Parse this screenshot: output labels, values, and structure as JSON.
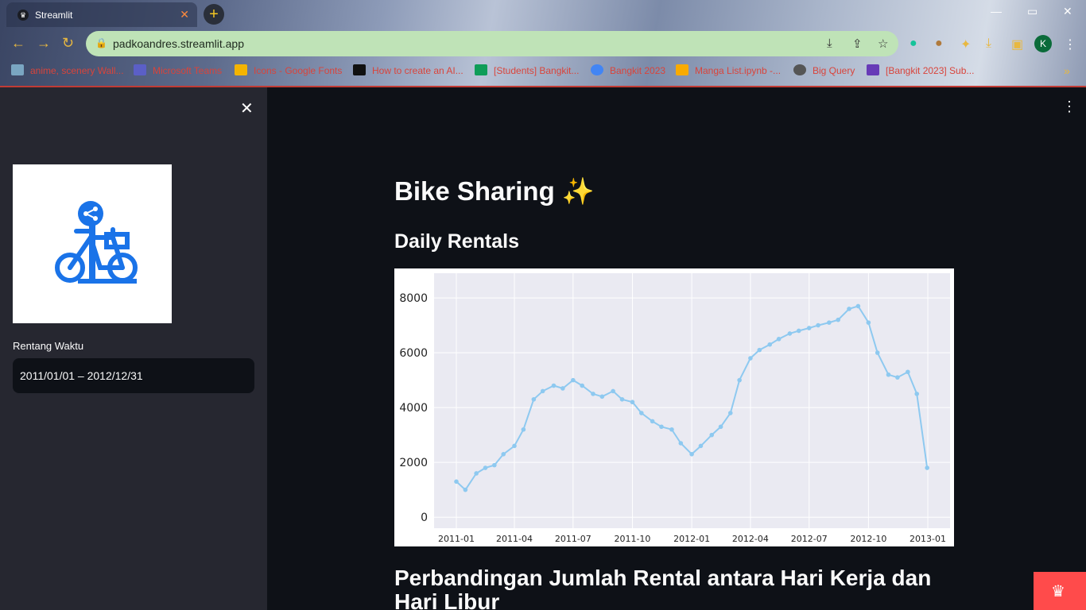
{
  "browser": {
    "tab_title": "Streamlit",
    "tab_close": "✕",
    "new_tab": "+",
    "url": "padkoandres.streamlit.app",
    "avatar_letter": "K",
    "bookmarks": [
      {
        "label": "anime, scenery Wall...",
        "icon": "image-icon",
        "color": "#7aa6c2"
      },
      {
        "label": "Microsoft Teams",
        "icon": "teams-icon",
        "color": "#5b5fc7"
      },
      {
        "label": "Icons - Google Fonts",
        "icon": "google-fonts-icon",
        "color": "#f4b400"
      },
      {
        "label": "How to create an AI...",
        "icon": "dev-icon",
        "color": "#111111"
      },
      {
        "label": "[Students] Bangkit...",
        "icon": "sheets-icon",
        "color": "#0f9d58"
      },
      {
        "label": "Bangkit 2023",
        "icon": "google-icon",
        "color": "#4285f4"
      },
      {
        "label": "Manga List.ipynb -...",
        "icon": "colab-icon",
        "color": "#f9ab00"
      },
      {
        "label": "Big Query",
        "icon": "bigquery-icon",
        "color": "#555555"
      },
      {
        "label": "[Bangkit 2023] Sub...",
        "icon": "forms-icon",
        "color": "#673ab7"
      }
    ],
    "more_bookmarks": "»"
  },
  "sidebar": {
    "close_icon": "✕",
    "date_range_label": "Rentang Waktu",
    "date_range_value": "2011/01/01 – 2012/12/31"
  },
  "main": {
    "title": "Bike Sharing ✨",
    "daily_header": "Daily Rentals",
    "compare_header": "Perbandingan Jumlah Rental antara Hari Kerja dan Hari Libur"
  },
  "colors": {
    "line": "#8ec9f0",
    "plot_bg": "#eaeaf2",
    "accent": "#ff4b4b"
  },
  "chart_data": {
    "type": "line",
    "title": "",
    "xlabel": "",
    "ylabel": "",
    "xlim": [
      "2011-01",
      "2013-01"
    ],
    "ylim": [
      -400,
      8900
    ],
    "x_ticks": [
      "2011-01",
      "2011-04",
      "2011-07",
      "2011-10",
      "2012-01",
      "2012-04",
      "2012-07",
      "2012-10",
      "2013-01"
    ],
    "y_ticks": [
      0,
      2000,
      4000,
      6000,
      8000
    ],
    "series": [
      {
        "x": [
          "2011-01-01",
          "2011-01-15",
          "2011-02-01",
          "2011-02-15",
          "2011-03-01",
          "2011-03-15",
          "2011-04-01",
          "2011-04-15",
          "2011-05-01",
          "2011-05-15",
          "2011-06-01",
          "2011-06-15",
          "2011-07-01",
          "2011-07-15",
          "2011-08-01",
          "2011-08-15",
          "2011-09-01",
          "2011-09-15",
          "2011-10-01",
          "2011-10-15",
          "2011-11-01",
          "2011-11-15",
          "2011-12-01",
          "2011-12-15",
          "2012-01-01",
          "2012-01-15",
          "2012-02-01",
          "2012-02-15",
          "2012-03-01",
          "2012-03-15",
          "2012-04-01",
          "2012-04-15",
          "2012-05-01",
          "2012-05-15",
          "2012-06-01",
          "2012-06-15",
          "2012-07-01",
          "2012-07-15",
          "2012-08-01",
          "2012-08-15",
          "2012-09-01",
          "2012-09-15",
          "2012-10-01",
          "2012-10-15",
          "2012-11-01",
          "2012-11-15",
          "2012-12-01",
          "2012-12-15",
          "2012-12-31"
        ],
        "values": [
          1300,
          1000,
          1600,
          1800,
          1900,
          2300,
          2600,
          3200,
          4300,
          4600,
          4800,
          4700,
          5000,
          4800,
          4500,
          4400,
          4600,
          4300,
          4200,
          3800,
          3500,
          3300,
          3200,
          2700,
          2300,
          2600,
          3000,
          3300,
          3800,
          5000,
          5800,
          6100,
          6300,
          6500,
          6700,
          6800,
          6900,
          7000,
          7100,
          7200,
          7600,
          7700,
          7100,
          6000,
          5200,
          5100,
          5300,
          4500,
          1800
        ]
      }
    ]
  }
}
